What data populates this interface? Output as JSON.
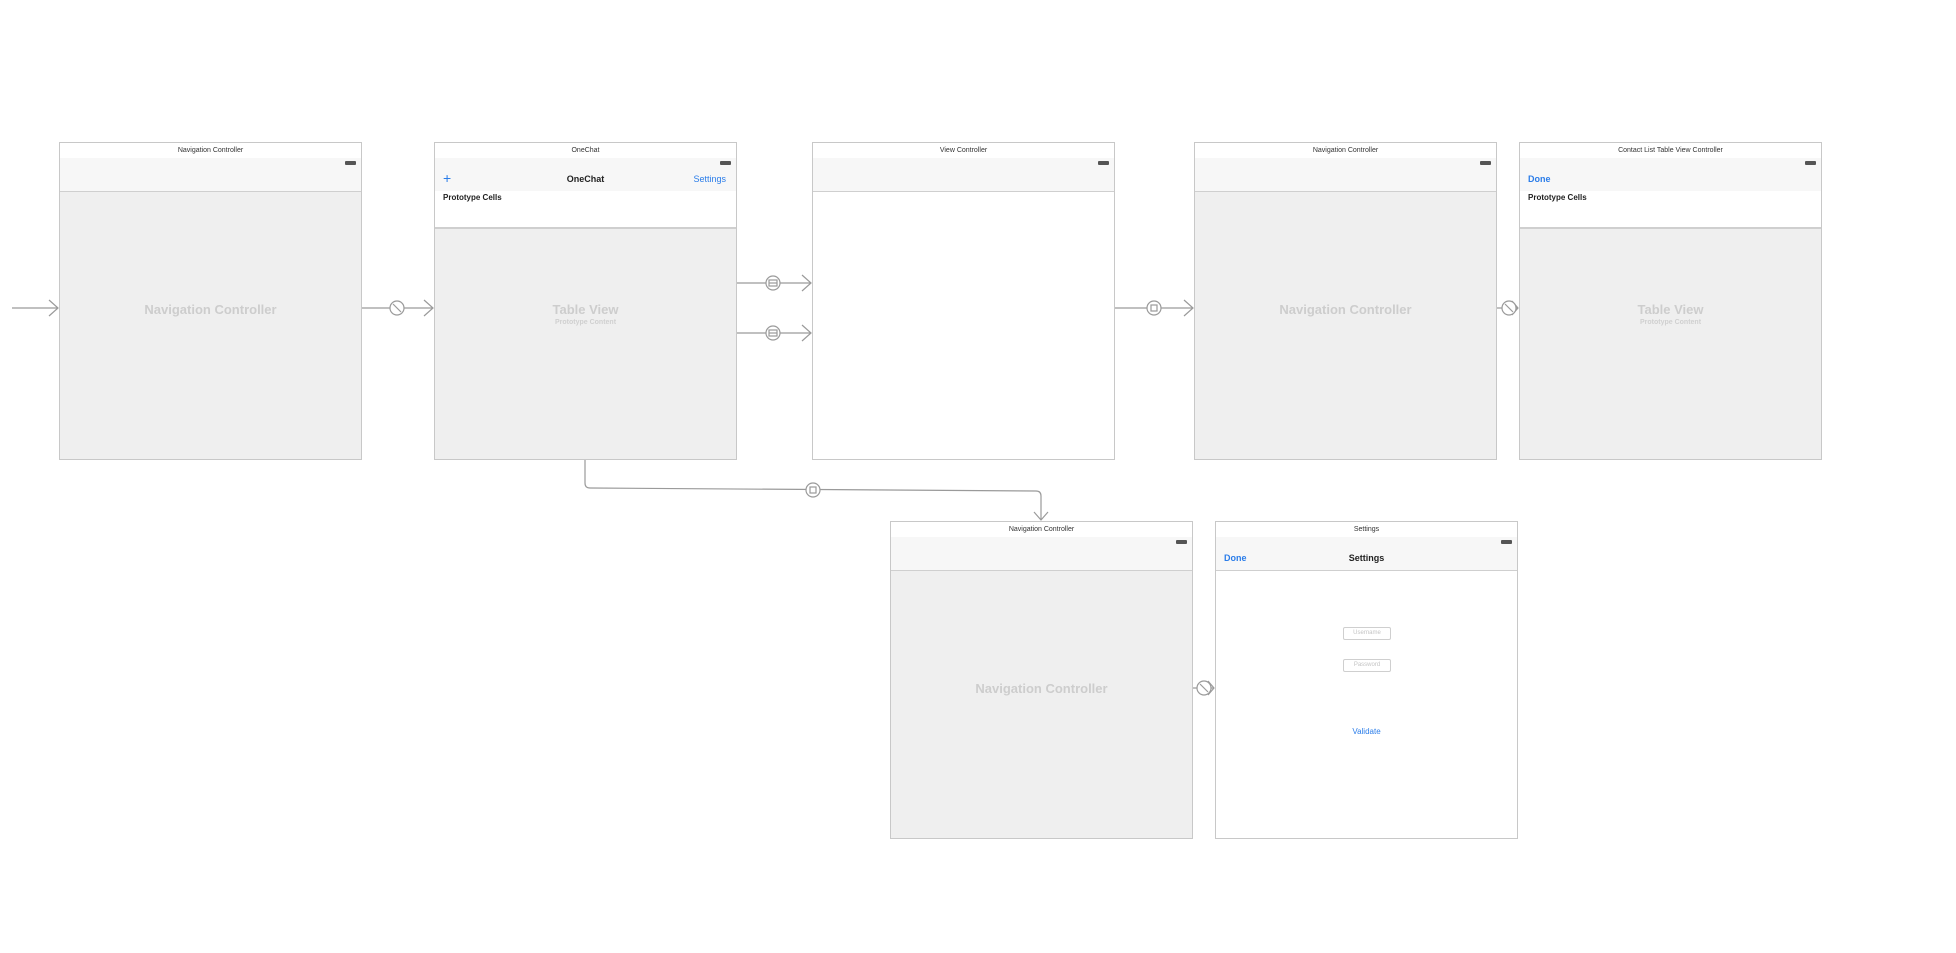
{
  "scenes": {
    "nav1": {
      "title": "Navigation Controller",
      "body_label": "Navigation Controller"
    },
    "onechat": {
      "title": "OneChat",
      "nav_title": "OneChat",
      "left_button": "+",
      "right_button": "Settings",
      "section_label": "Prototype Cells",
      "body_label": "Table View",
      "body_sublabel": "Prototype Content"
    },
    "viewcontroller": {
      "title": "View Controller"
    },
    "nav2": {
      "title": "Navigation Controller",
      "body_label": "Navigation Controller"
    },
    "contactlist": {
      "title": "Contact List Table View Controller",
      "left_button": "Done",
      "section_label": "Prototype Cells",
      "body_label": "Table View",
      "body_sublabel": "Prototype Content"
    },
    "nav3": {
      "title": "Navigation Controller",
      "body_label": "Navigation Controller"
    },
    "settings": {
      "title": "Settings",
      "nav_title": "Settings",
      "left_button": "Done",
      "username_placeholder": "Username",
      "password_placeholder": "Password",
      "validate_label": "Validate"
    }
  },
  "colors": {
    "accent": "#2b7de9",
    "segue_line": "#9a9a9a",
    "scene_border": "#c8c8c8",
    "placeholder_gray": "#efefef"
  },
  "icons": [
    "battery-icon",
    "plus-icon",
    "segue-relationship-icon",
    "segue-show-icon",
    "segue-present-icon",
    "entry-arrow-icon"
  ]
}
